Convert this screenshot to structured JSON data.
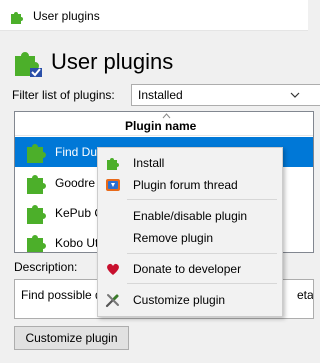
{
  "window": {
    "title": "User plugins"
  },
  "header": {
    "title": "User plugins"
  },
  "filter": {
    "label": "Filter list of plugins:",
    "selected": "Installed"
  },
  "table": {
    "column_header": "Plugin name",
    "rows": [
      {
        "label": "Find Duplicat",
        "selected": true
      },
      {
        "label": "Goodre"
      },
      {
        "label": "KePub C"
      },
      {
        "label": "Kobo Ut"
      }
    ]
  },
  "description": {
    "label": "Description:",
    "text": "Find possible d",
    "text_suffix": "etad"
  },
  "buttons": {
    "customize_plugin": "Customize plugin"
  },
  "context_menu": {
    "items": [
      {
        "label": "Install",
        "icon": "puzzle-piece-icon"
      },
      {
        "label": "Plugin forum thread",
        "icon": "forum-icon"
      },
      {
        "label": "Enable/disable plugin",
        "icon": ""
      },
      {
        "label": "Remove plugin",
        "icon": ""
      },
      {
        "label": "Donate to developer",
        "icon": "heart-icon"
      },
      {
        "label": "Customize plugin",
        "icon": "tools-icon"
      }
    ]
  },
  "colors": {
    "selection": "#0078d7",
    "plugin_green": "#4caf2a",
    "heart_red": "#c8102e"
  }
}
